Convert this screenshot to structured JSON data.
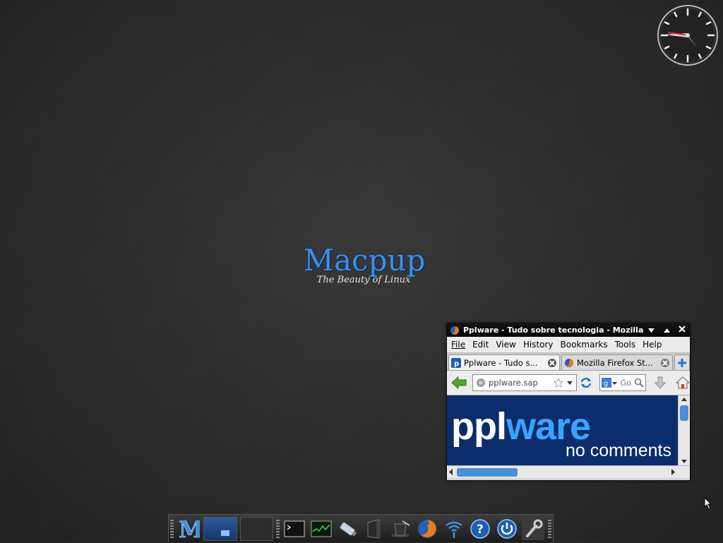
{
  "desktop": {
    "logo_title": "Macpup",
    "logo_subtitle": "The Beauty of Linux"
  },
  "firefox": {
    "window_title": "Pplware - Tudo sobre tecnologia - Mozilla ...",
    "menu": [
      "File",
      "Edit",
      "View",
      "History",
      "Bookmarks",
      "Tools",
      "Help"
    ],
    "tabs": [
      {
        "label": "Pplware - Tudo s..."
      },
      {
        "label": "Mozilla Firefox St..."
      }
    ],
    "url": "pplware.sap",
    "search_placeholder": "Go",
    "banner": {
      "brand": "pplware",
      "tagline": "no comments"
    }
  },
  "taskbar": {
    "icons": [
      "macpup-menu-icon",
      "terminal-icon",
      "system-monitor-icon",
      "usb-drive-icon",
      "file-manager-icon",
      "magic-hat-icon",
      "firefox-icon",
      "wifi-icon",
      "help-icon",
      "power-icon",
      "settings-wrench-icon"
    ]
  },
  "colors": {
    "accent": "#3d8ee6",
    "banner_bg": "#0b2d6c"
  }
}
